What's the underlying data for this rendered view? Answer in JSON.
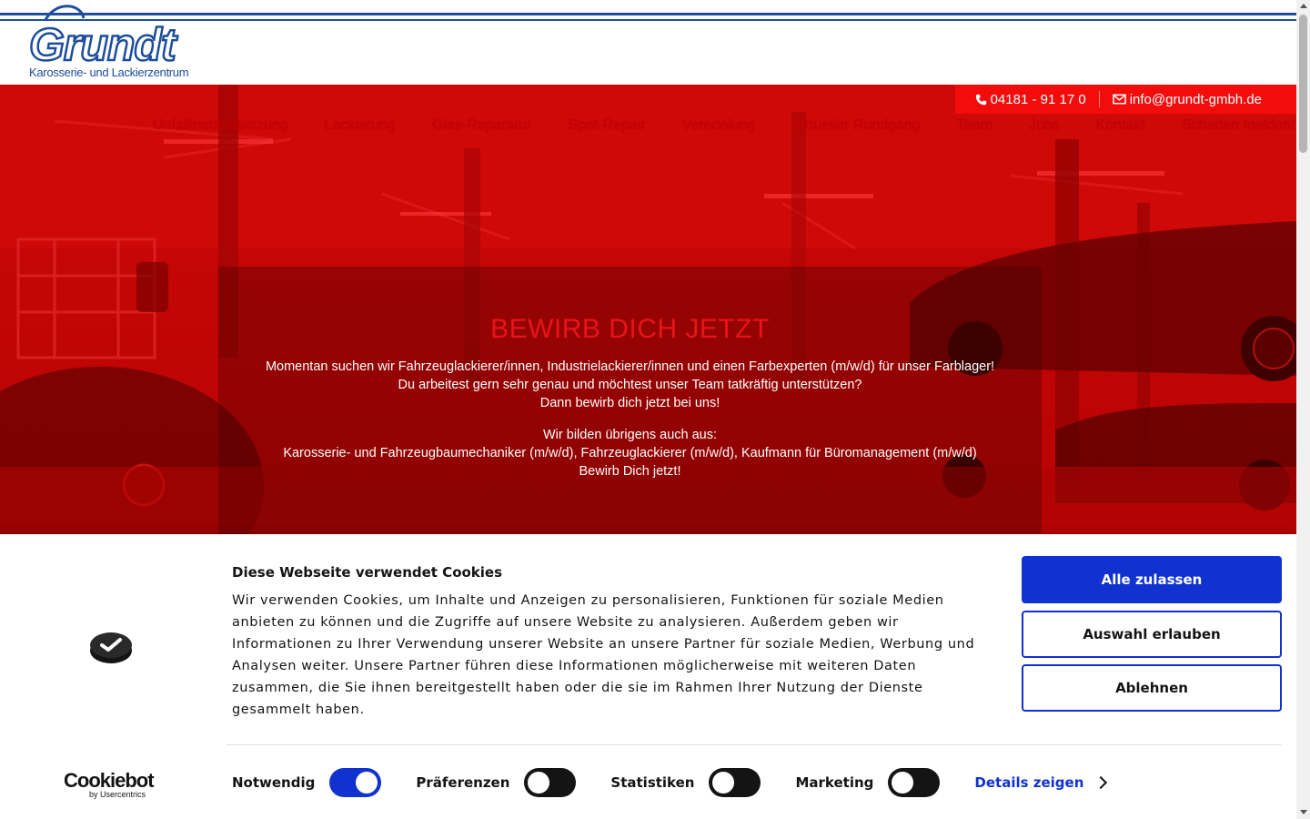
{
  "header": {
    "logo_text": "Grundt",
    "logo_tagline": "Karosserie- und Lackierzentrum"
  },
  "contact": {
    "phone": "04181 - 91 17 0",
    "email": "info@grundt-gmbh.de"
  },
  "nav": {
    "items": [
      {
        "label": "Unfallinstandsetzung"
      },
      {
        "label": "Lackierung"
      },
      {
        "label": "Glas-Reparatur"
      },
      {
        "label": "Spot-Repair"
      },
      {
        "label": "Veredelung"
      },
      {
        "label": "Virtueller Rundgang"
      },
      {
        "label": "Team"
      },
      {
        "label": "Jobs"
      },
      {
        "label": "Kontakt"
      },
      {
        "label": "Schaden melden!"
      }
    ]
  },
  "hero": {
    "title": "BEWIRB DICH JETZT",
    "line1": "Momentan suchen wir Fahrzeuglackierer/innen, Industrielackierer/innen und einen Farbexperten (m/w/d) für unser Farblager!",
    "line2": "Du arbeitest gern sehr genau und möchtest unser Team tatkräftig unterstützen?",
    "line3": "Dann bewirb dich jetzt bei uns!",
    "line4": "Wir bilden übrigens auch aus:",
    "line5": "Karosserie- und Fahrzeugbaumechaniker (m/w/d), Fahrzeuglackierer (m/w/d), Kaufmann für Büromanagement (m/w/d)",
    "line6": "Bewirb Dich jetzt!"
  },
  "cookie": {
    "title": "Diese Webseite verwendet Cookies",
    "body": "Wir verwenden Cookies, um Inhalte und Anzeigen zu personalisieren, Funktionen für soziale Medien anbieten zu können und die Zugriffe auf unsere Website zu analysieren. Außerdem geben wir Informationen zu Ihrer Verwendung unserer Website an unsere Partner für soziale Medien, Werbung und Analysen weiter. Unsere Partner führen diese Informationen möglicherweise mit weiteren Daten zusammen, die Sie ihnen bereitgestellt haben oder die sie im Rahmen Ihrer Nutzung der Dienste gesammelt haben.",
    "allow_all": "Alle zulassen",
    "allow_selection": "Auswahl erlauben",
    "deny": "Ablehnen",
    "toggles": [
      {
        "label": "Notwendig",
        "on": true
      },
      {
        "label": "Präferenzen",
        "on": false
      },
      {
        "label": "Statistiken",
        "on": false
      },
      {
        "label": "Marketing",
        "on": false
      }
    ],
    "details": "Details zeigen",
    "brand": "Cookiebot",
    "brand_sub": "by Usercentrics"
  },
  "colors": {
    "brand_blue": "#1d4d9c",
    "hero_red": "#c30505",
    "button_blue": "#1032cf"
  }
}
